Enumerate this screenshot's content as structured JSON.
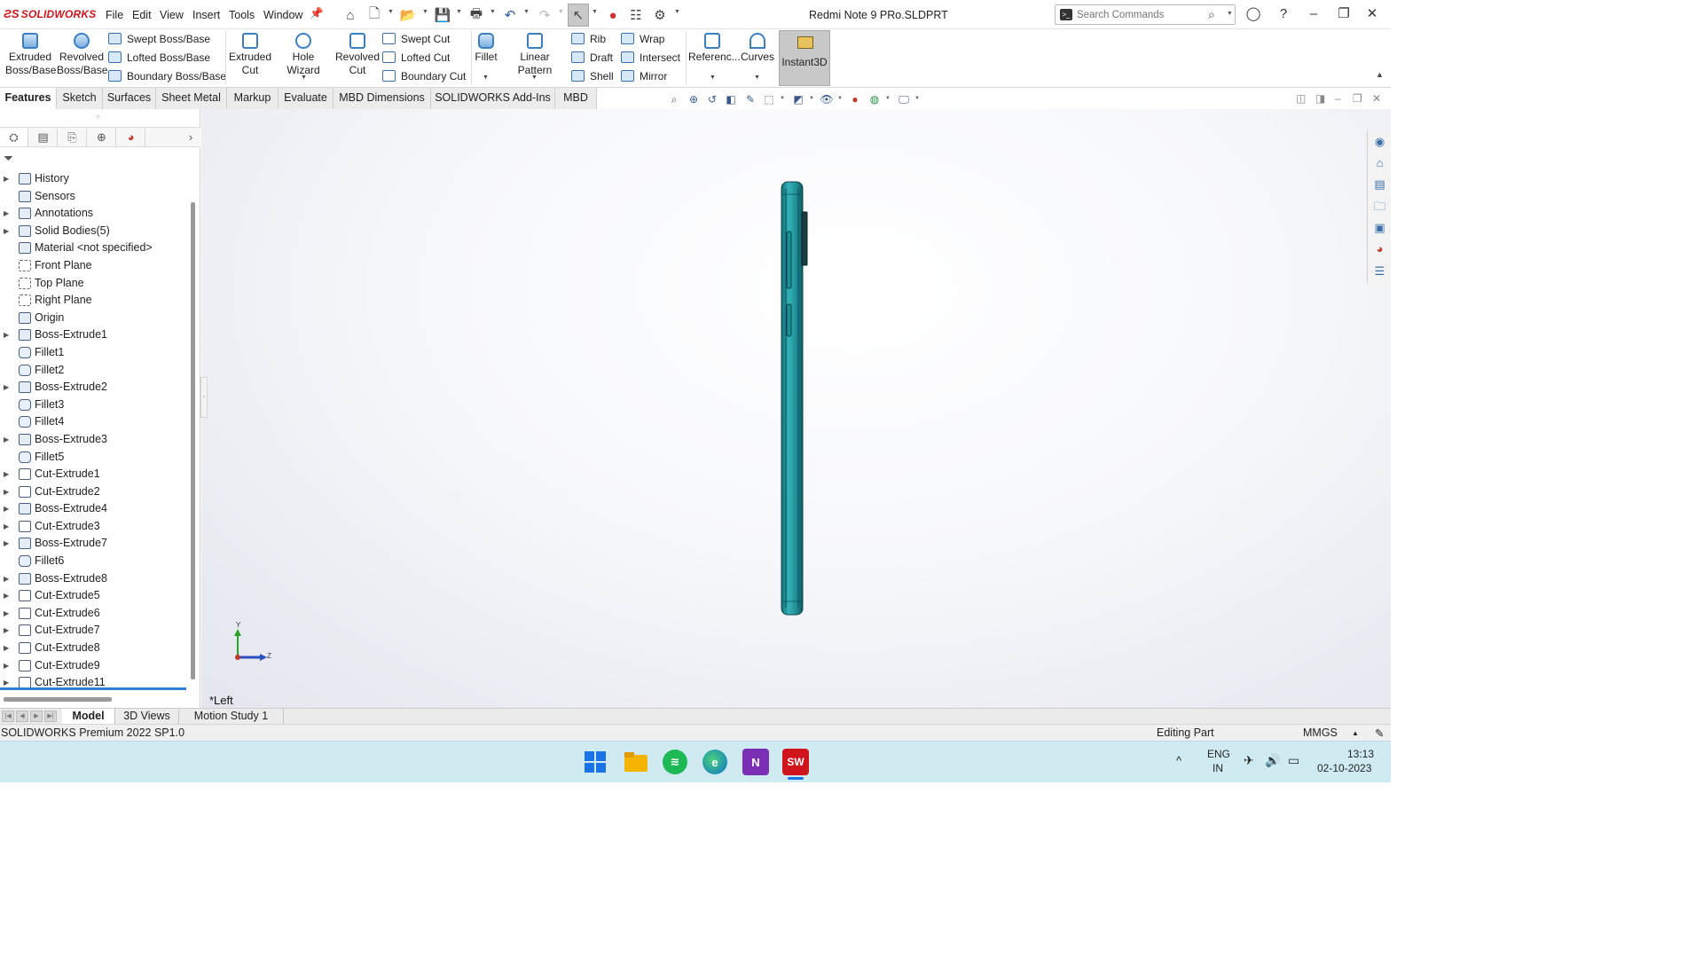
{
  "app": {
    "logo_text": "SOLIDWORKS",
    "document_title": "Redmi Note 9 PRo.SLDPRT"
  },
  "menu": [
    "File",
    "Edit",
    "View",
    "Insert",
    "Tools",
    "Window"
  ],
  "search": {
    "placeholder": "Search Commands"
  },
  "commands": {
    "extruded_boss": [
      "Extruded",
      "Boss/Base"
    ],
    "revolved_boss": [
      "Revolved",
      "Boss/Base"
    ],
    "swept_boss": "Swept Boss/Base",
    "lofted_boss": "Lofted Boss/Base",
    "boundary_boss": "Boundary Boss/Base",
    "extruded_cut": [
      "Extruded",
      "Cut"
    ],
    "hole_wizard": "Hole Wizard",
    "revolved_cut": [
      "Revolved",
      "Cut"
    ],
    "swept_cut": "Swept Cut",
    "lofted_cut": "Lofted Cut",
    "boundary_cut": "Boundary Cut",
    "fillet": "Fillet",
    "linear_pattern": "Linear Pattern",
    "rib": "Rib",
    "draft": "Draft",
    "shell": "Shell",
    "wrap": "Wrap",
    "intersect": "Intersect",
    "mirror": "Mirror",
    "reference": "Referenc...",
    "curves": "Curves",
    "instant3d": "Instant3D"
  },
  "tabs": [
    "Features",
    "Sketch",
    "Surfaces",
    "Sheet Metal",
    "Markup",
    "Evaluate",
    "MBD Dimensions",
    "SOLIDWORKS Add-Ins",
    "MBD"
  ],
  "tree": [
    {
      "label": "History",
      "icon": "history-icon",
      "expandable": true
    },
    {
      "label": "Sensors",
      "icon": "sensors-icon",
      "expandable": false
    },
    {
      "label": "Annotations",
      "icon": "annotations-icon",
      "expandable": true
    },
    {
      "label": "Solid Bodies(5)",
      "icon": "solid-bodies-icon",
      "expandable": true
    },
    {
      "label": "Material <not specified>",
      "icon": "material-icon",
      "expandable": false
    },
    {
      "label": "Front Plane",
      "icon": "plane-icon",
      "expandable": false
    },
    {
      "label": "Top Plane",
      "icon": "plane-icon",
      "expandable": false
    },
    {
      "label": "Right Plane",
      "icon": "plane-icon",
      "expandable": false
    },
    {
      "label": "Origin",
      "icon": "origin-icon",
      "expandable": false
    },
    {
      "label": "Boss-Extrude1",
      "icon": "boss-extrude-icon",
      "expandable": true
    },
    {
      "label": "Fillet1",
      "icon": "fillet-icon",
      "expandable": false
    },
    {
      "label": "Fillet2",
      "icon": "fillet-icon",
      "expandable": false
    },
    {
      "label": "Boss-Extrude2",
      "icon": "boss-extrude-icon",
      "expandable": true
    },
    {
      "label": "Fillet3",
      "icon": "fillet-icon",
      "expandable": false
    },
    {
      "label": "Fillet4",
      "icon": "fillet-icon",
      "expandable": false
    },
    {
      "label": "Boss-Extrude3",
      "icon": "boss-extrude-icon",
      "expandable": true
    },
    {
      "label": "Fillet5",
      "icon": "fillet-icon",
      "expandable": false
    },
    {
      "label": "Cut-Extrude1",
      "icon": "cut-extrude-icon",
      "expandable": true
    },
    {
      "label": "Cut-Extrude2",
      "icon": "cut-extrude-icon",
      "expandable": true
    },
    {
      "label": "Boss-Extrude4",
      "icon": "boss-extrude-icon",
      "expandable": true
    },
    {
      "label": "Cut-Extrude3",
      "icon": "cut-extrude-icon",
      "expandable": true
    },
    {
      "label": "Boss-Extrude7",
      "icon": "boss-extrude-icon",
      "expandable": true
    },
    {
      "label": "Fillet6",
      "icon": "fillet-icon",
      "expandable": false
    },
    {
      "label": "Boss-Extrude8",
      "icon": "boss-extrude-icon",
      "expandable": true
    },
    {
      "label": "Cut-Extrude5",
      "icon": "cut-extrude-icon",
      "expandable": true
    },
    {
      "label": "Cut-Extrude6",
      "icon": "cut-extrude-icon",
      "expandable": true
    },
    {
      "label": "Cut-Extrude7",
      "icon": "cut-extrude-icon",
      "expandable": true
    },
    {
      "label": "Cut-Extrude8",
      "icon": "cut-extrude-icon",
      "expandable": true
    },
    {
      "label": "Cut-Extrude9",
      "icon": "cut-extrude-icon",
      "expandable": true
    },
    {
      "label": "Cut-Extrude11",
      "icon": "cut-extrude-icon",
      "expandable": true
    }
  ],
  "viewport": {
    "view_label": "*Left",
    "triad_y": "Y",
    "triad_z": "Z",
    "model_color": "#2a9ea3"
  },
  "bottom_tabs": [
    "Model",
    "3D Views",
    "Motion Study 1"
  ],
  "status": {
    "product": "SOLIDWORKS Premium 2022 SP1.0",
    "mode": "Editing Part",
    "units": "MMGS"
  },
  "taskbar": {
    "lang_line1": "ENG",
    "lang_line2": "IN",
    "time": "13:13",
    "date": "02-10-2023"
  }
}
